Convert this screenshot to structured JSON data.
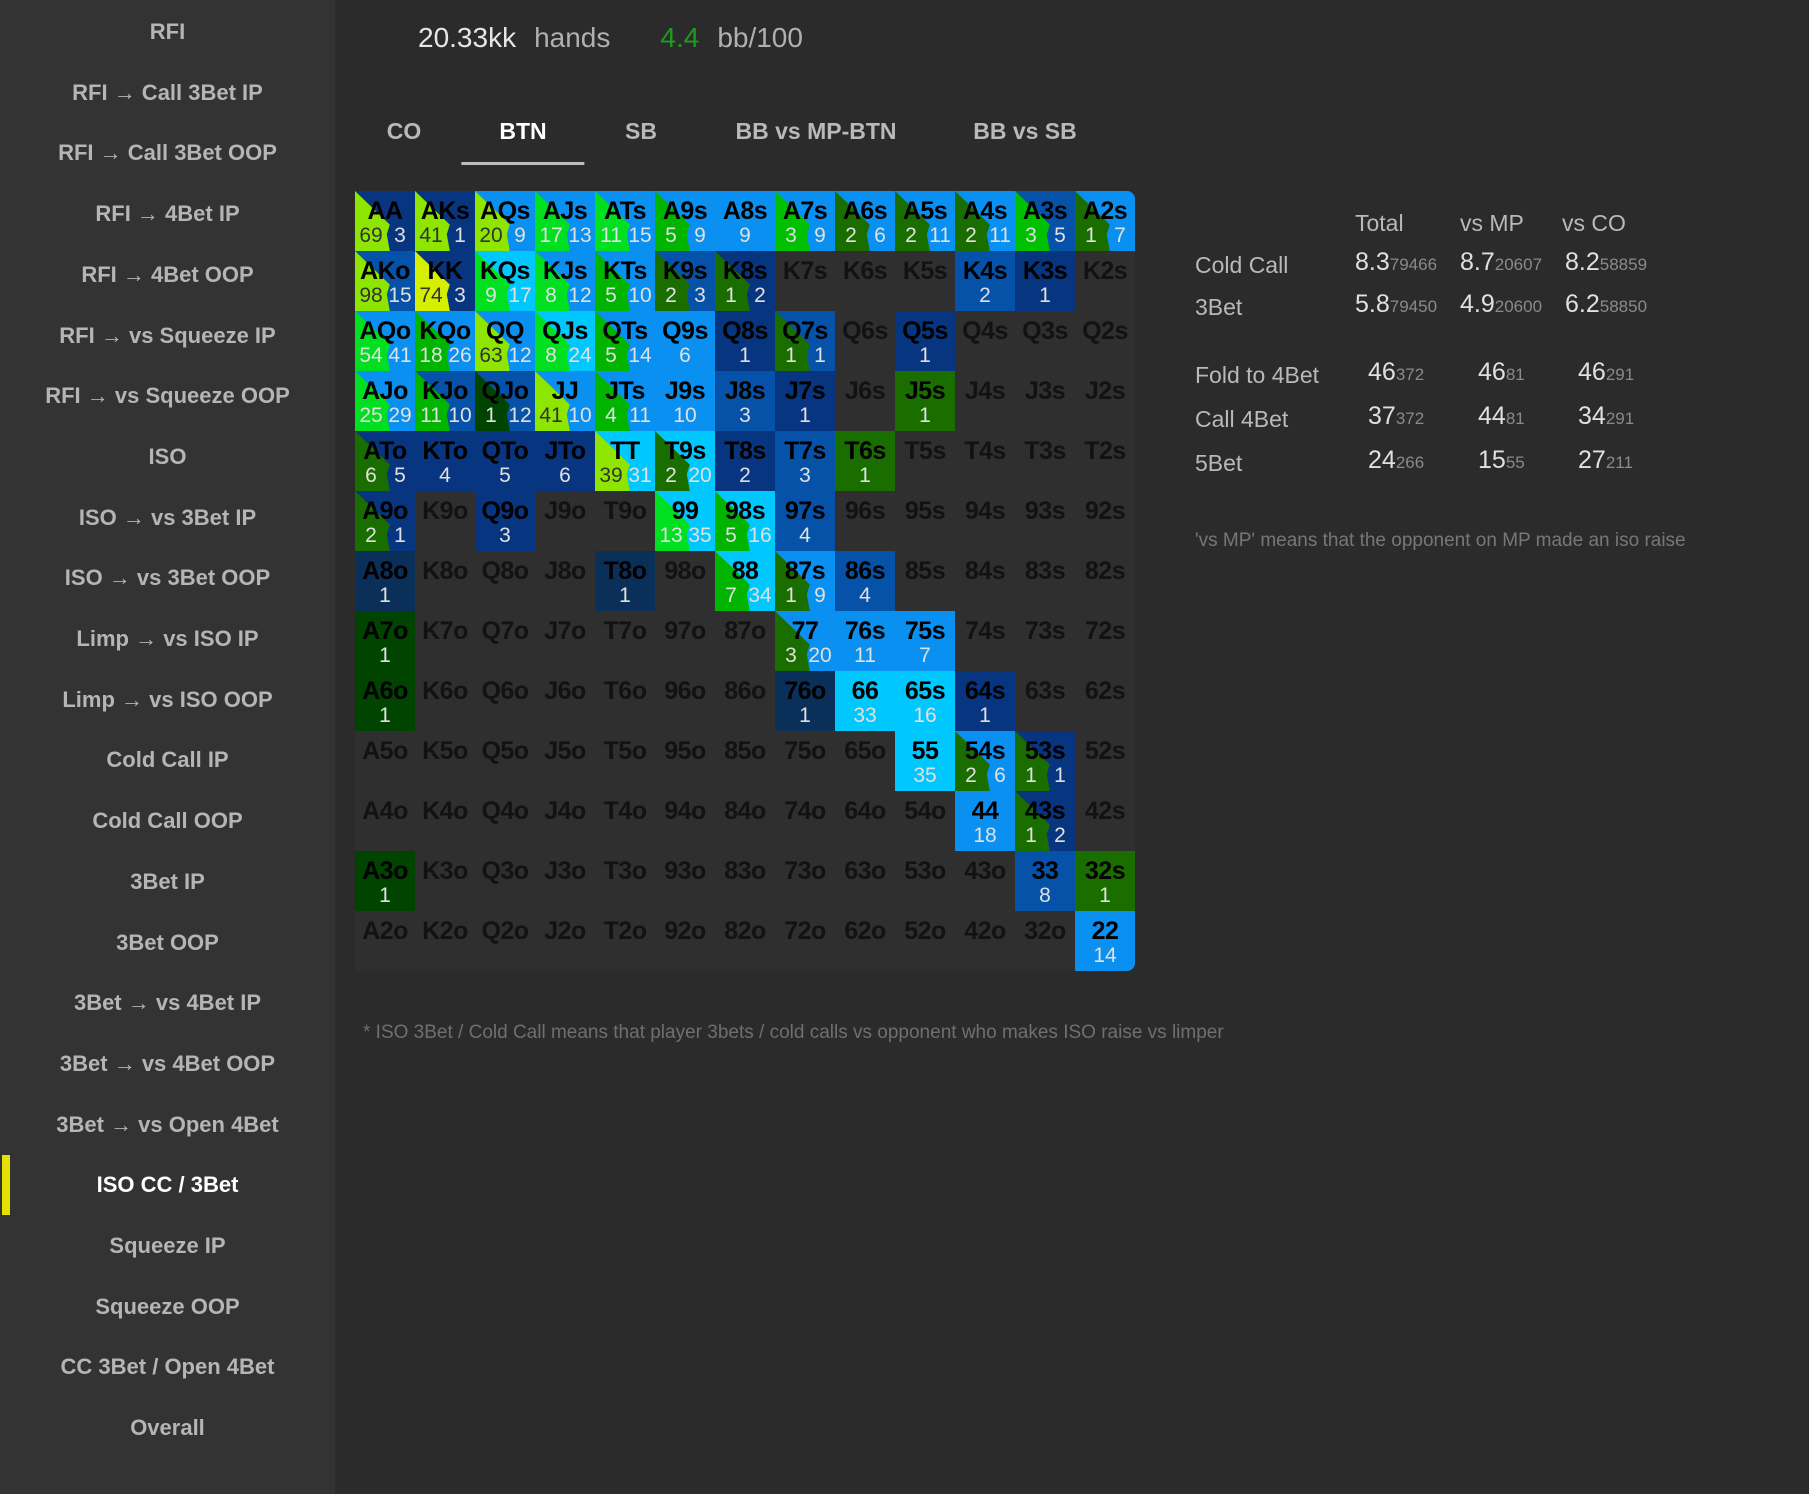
{
  "sidebar": {
    "items": [
      "RFI",
      "RFI → Call 3Bet IP",
      "RFI → Call 3Bet OOP",
      "RFI → 4Bet IP",
      "RFI → 4Bet OOP",
      "RFI → vs Squeeze IP",
      "RFI → vs Squeeze OOP",
      "ISO",
      "ISO → vs 3Bet IP",
      "ISO → vs 3Bet OOP",
      "Limp → vs ISO IP",
      "Limp → vs ISO OOP",
      "Cold Call IP",
      "Cold Call OOP",
      "3Bet IP",
      "3Bet OOP",
      "3Bet → vs 4Bet IP",
      "3Bet → vs 4Bet OOP",
      "3Bet → vs Open 4Bet",
      "ISO CC / 3Bet",
      "Squeeze IP",
      "Squeeze OOP",
      "CC 3Bet / Open 4Bet",
      "Overall"
    ],
    "active": "ISO CC / 3Bet",
    "active_color": "#e4e000"
  },
  "header": {
    "hands": "20.33kk",
    "hands_label": "hands",
    "winrate": "4.4",
    "winrate_label": "bb/100",
    "winrate_color": "#1f9a1f"
  },
  "tabs": {
    "items": [
      "CO",
      "BTN",
      "SB",
      "BB vs MP-BTN",
      "BB vs SB"
    ],
    "active": "BTN"
  },
  "grid": [
    [
      {
        "h": "AA",
        "a": "69",
        "b": "3",
        "c1": "#8ee600",
        "c2": "#08357f"
      },
      {
        "h": "AKs",
        "a": "41",
        "b": "1",
        "c1": "#8ee600",
        "c2": "#08357f"
      },
      {
        "h": "AQs",
        "a": "20",
        "b": "9",
        "c1": "#8ee600",
        "c2": "#0a90f0"
      },
      {
        "h": "AJs",
        "a": "17",
        "b": "13",
        "c1": "#00e020",
        "c2": "#0a90f0"
      },
      {
        "h": "ATs",
        "a": "11",
        "b": "15",
        "c1": "#00e020",
        "c2": "#0a90f0"
      },
      {
        "h": "A9s",
        "a": "5",
        "b": "9",
        "c1": "#00b400",
        "c2": "#0a90f0"
      },
      {
        "h": "A8s",
        "v": "9",
        "c2": "#0a90f0"
      },
      {
        "h": "A7s",
        "a": "3",
        "b": "9",
        "c1": "#00c000",
        "c2": "#0a90f0"
      },
      {
        "h": "A6s",
        "a": "2",
        "b": "6",
        "c1": "#1a6e00",
        "c2": "#0a90f0"
      },
      {
        "h": "A5s",
        "a": "2",
        "b": "11",
        "c1": "#1a6e00",
        "c2": "#0a90f0"
      },
      {
        "h": "A4s",
        "a": "2",
        "b": "11",
        "c1": "#1a6e00",
        "c2": "#0a90f0"
      },
      {
        "h": "A3s",
        "a": "3",
        "b": "5",
        "c1": "#00c000",
        "c2": "#0652a8"
      },
      {
        "h": "A2s",
        "a": "1",
        "b": "7",
        "c1": "#1a6e00",
        "c2": "#0a90f0"
      }
    ],
    [
      {
        "h": "AKo",
        "a": "98",
        "b": "15",
        "c1": "#8ee600",
        "c2": "#0652a8"
      },
      {
        "h": "KK",
        "a": "74",
        "b": "3",
        "c1": "#d4f000",
        "c2": "#08357f"
      },
      {
        "h": "KQs",
        "a": "9",
        "b": "17",
        "c1": "#00e020",
        "c2": "#00c8ff"
      },
      {
        "h": "KJs",
        "a": "8",
        "b": "12",
        "c1": "#00e020",
        "c2": "#0a90f0"
      },
      {
        "h": "KTs",
        "a": "5",
        "b": "10",
        "c1": "#00b400",
        "c2": "#0a90f0"
      },
      {
        "h": "K9s",
        "a": "2",
        "b": "3",
        "c1": "#1a6e00",
        "c2": "#0652a8"
      },
      {
        "h": "K8s",
        "a": "1",
        "b": "2",
        "c1": "#1a6e00",
        "c2": "#08357f"
      },
      {
        "h": "K7s"
      },
      {
        "h": "K6s"
      },
      {
        "h": "K5s"
      },
      {
        "h": "K4s",
        "v": "2",
        "c2": "#0652a8"
      },
      {
        "h": "K3s",
        "v": "1",
        "c2": "#08357f"
      },
      {
        "h": "K2s"
      }
    ],
    [
      {
        "h": "AQo",
        "a": "54",
        "b": "41",
        "c1": "#00e020",
        "c2": "#0a90f0"
      },
      {
        "h": "KQo",
        "a": "18",
        "b": "26",
        "c1": "#00b400",
        "c2": "#0a90f0"
      },
      {
        "h": "QQ",
        "a": "63",
        "b": "12",
        "c1": "#8ee600",
        "c2": "#0a90f0"
      },
      {
        "h": "QJs",
        "a": "8",
        "b": "24",
        "c1": "#00e020",
        "c2": "#00c8ff"
      },
      {
        "h": "QTs",
        "a": "5",
        "b": "14",
        "c1": "#00b400",
        "c2": "#0a90f0"
      },
      {
        "h": "Q9s",
        "v": "6",
        "c2": "#0a90f0"
      },
      {
        "h": "Q8s",
        "v": "1",
        "c2": "#08357f"
      },
      {
        "h": "Q7s",
        "a": "1",
        "b": "1",
        "c1": "#1a6e00",
        "c2": "#0652a8"
      },
      {
        "h": "Q6s"
      },
      {
        "h": "Q5s",
        "v": "1",
        "c2": "#08357f"
      },
      {
        "h": "Q4s"
      },
      {
        "h": "Q3s"
      },
      {
        "h": "Q2s"
      }
    ],
    [
      {
        "h": "AJo",
        "a": "25",
        "b": "29",
        "c1": "#00e020",
        "c2": "#0a90f0"
      },
      {
        "h": "KJo",
        "a": "11",
        "b": "10",
        "c1": "#00b400",
        "c2": "#0652a8"
      },
      {
        "h": "QJo",
        "a": "1",
        "b": "12",
        "c1": "#004400",
        "c2": "#0652a8"
      },
      {
        "h": "JJ",
        "a": "41",
        "b": "10",
        "c1": "#8ee600",
        "c2": "#0a90f0"
      },
      {
        "h": "JTs",
        "a": "4",
        "b": "11",
        "c1": "#00b400",
        "c2": "#0a90f0"
      },
      {
        "h": "J9s",
        "v": "10",
        "c2": "#0a90f0"
      },
      {
        "h": "J8s",
        "v": "3",
        "c2": "#0652a8"
      },
      {
        "h": "J7s",
        "v": "1",
        "c2": "#08357f"
      },
      {
        "h": "J6s"
      },
      {
        "h": "J5s",
        "v": "1",
        "c2": "#1a6e00"
      },
      {
        "h": "J4s"
      },
      {
        "h": "J3s"
      },
      {
        "h": "J2s"
      }
    ],
    [
      {
        "h": "ATo",
        "a": "6",
        "b": "5",
        "c1": "#1a6e00",
        "c2": "#08357f"
      },
      {
        "h": "KTo",
        "v": "4",
        "c2": "#08357f"
      },
      {
        "h": "QTo",
        "v": "5",
        "c2": "#08357f"
      },
      {
        "h": "JTo",
        "v": "6",
        "c2": "#08357f"
      },
      {
        "h": "TT",
        "a": "39",
        "b": "31",
        "c1": "#8ee600",
        "c2": "#00c8ff"
      },
      {
        "h": "T9s",
        "a": "2",
        "b": "20",
        "c1": "#1a6e00",
        "c2": "#00c8ff"
      },
      {
        "h": "T8s",
        "v": "2",
        "c2": "#08357f"
      },
      {
        "h": "T7s",
        "v": "3",
        "c2": "#0652a8"
      },
      {
        "h": "T6s",
        "v": "1",
        "c2": "#1a6e00"
      },
      {
        "h": "T5s"
      },
      {
        "h": "T4s"
      },
      {
        "h": "T3s"
      },
      {
        "h": "T2s"
      }
    ],
    [
      {
        "h": "A9o",
        "a": "2",
        "b": "1",
        "c1": "#1a6e00",
        "c2": "#08357f"
      },
      {
        "h": "K9o"
      },
      {
        "h": "Q9o",
        "v": "3",
        "c2": "#08357f"
      },
      {
        "h": "J9o"
      },
      {
        "h": "T9o"
      },
      {
        "h": "99",
        "a": "13",
        "b": "35",
        "c1": "#00e020",
        "c2": "#00c8ff"
      },
      {
        "h": "98s",
        "a": "5",
        "b": "16",
        "c1": "#00b400",
        "c2": "#00c8ff"
      },
      {
        "h": "97s",
        "v": "4",
        "c2": "#0652a8"
      },
      {
        "h": "96s"
      },
      {
        "h": "95s"
      },
      {
        "h": "94s"
      },
      {
        "h": "93s"
      },
      {
        "h": "92s"
      }
    ],
    [
      {
        "h": "A8o",
        "v": "1",
        "c2": "#0a3059"
      },
      {
        "h": "K8o"
      },
      {
        "h": "Q8o"
      },
      {
        "h": "J8o"
      },
      {
        "h": "T8o",
        "v": "1",
        "c2": "#0a3059"
      },
      {
        "h": "98o"
      },
      {
        "h": "88",
        "a": "7",
        "b": "34",
        "c1": "#00b400",
        "c2": "#00c8ff"
      },
      {
        "h": "87s",
        "a": "1",
        "b": "9",
        "c1": "#1a6e00",
        "c2": "#0a90f0"
      },
      {
        "h": "86s",
        "v": "4",
        "c2": "#0652a8"
      },
      {
        "h": "85s"
      },
      {
        "h": "84s"
      },
      {
        "h": "83s"
      },
      {
        "h": "82s"
      }
    ],
    [
      {
        "h": "A7o",
        "v": "1",
        "c2": "#004400"
      },
      {
        "h": "K7o"
      },
      {
        "h": "Q7o"
      },
      {
        "h": "J7o"
      },
      {
        "h": "T7o"
      },
      {
        "h": "97o"
      },
      {
        "h": "87o"
      },
      {
        "h": "77",
        "a": "3",
        "b": "20",
        "c1": "#1a6e00",
        "c2": "#0a90f0"
      },
      {
        "h": "76s",
        "v": "11",
        "c2": "#0a90f0"
      },
      {
        "h": "75s",
        "v": "7",
        "c2": "#0a90f0"
      },
      {
        "h": "74s"
      },
      {
        "h": "73s"
      },
      {
        "h": "72s"
      }
    ],
    [
      {
        "h": "A6o",
        "v": "1",
        "c2": "#004400"
      },
      {
        "h": "K6o"
      },
      {
        "h": "Q6o"
      },
      {
        "h": "J6o"
      },
      {
        "h": "T6o"
      },
      {
        "h": "96o"
      },
      {
        "h": "86o"
      },
      {
        "h": "76o",
        "v": "1",
        "c2": "#0a3059"
      },
      {
        "h": "66",
        "v": "33",
        "c2": "#00c8ff"
      },
      {
        "h": "65s",
        "v": "16",
        "c2": "#00c8ff"
      },
      {
        "h": "64s",
        "v": "1",
        "c2": "#08357f"
      },
      {
        "h": "63s"
      },
      {
        "h": "62s"
      }
    ],
    [
      {
        "h": "A5o"
      },
      {
        "h": "K5o"
      },
      {
        "h": "Q5o"
      },
      {
        "h": "J5o"
      },
      {
        "h": "T5o"
      },
      {
        "h": "95o"
      },
      {
        "h": "85o"
      },
      {
        "h": "75o"
      },
      {
        "h": "65o"
      },
      {
        "h": "55",
        "v": "35",
        "c2": "#00c8ff"
      },
      {
        "h": "54s",
        "a": "2",
        "b": "6",
        "c1": "#1a6e00",
        "c2": "#0a90f0"
      },
      {
        "h": "53s",
        "a": "1",
        "b": "1",
        "c1": "#1a6e00",
        "c2": "#08357f"
      },
      {
        "h": "52s"
      }
    ],
    [
      {
        "h": "A4o"
      },
      {
        "h": "K4o"
      },
      {
        "h": "Q4o"
      },
      {
        "h": "J4o"
      },
      {
        "h": "T4o"
      },
      {
        "h": "94o"
      },
      {
        "h": "84o"
      },
      {
        "h": "74o"
      },
      {
        "h": "64o"
      },
      {
        "h": "54o"
      },
      {
        "h": "44",
        "v": "18",
        "c2": "#0a90f0"
      },
      {
        "h": "43s",
        "a": "1",
        "b": "2",
        "c1": "#1a6e00",
        "c2": "#08357f"
      },
      {
        "h": "42s"
      }
    ],
    [
      {
        "h": "A3o",
        "v": "1",
        "c2": "#004400"
      },
      {
        "h": "K3o"
      },
      {
        "h": "Q3o"
      },
      {
        "h": "J3o"
      },
      {
        "h": "T3o"
      },
      {
        "h": "93o"
      },
      {
        "h": "83o"
      },
      {
        "h": "73o"
      },
      {
        "h": "63o"
      },
      {
        "h": "53o"
      },
      {
        "h": "43o"
      },
      {
        "h": "33",
        "v": "8",
        "c2": "#0652a8"
      },
      {
        "h": "32s",
        "v": "1",
        "c2": "#1a6e00"
      }
    ],
    [
      {
        "h": "A2o"
      },
      {
        "h": "K2o"
      },
      {
        "h": "Q2o"
      },
      {
        "h": "J2o"
      },
      {
        "h": "T2o"
      },
      {
        "h": "92o"
      },
      {
        "h": "82o"
      },
      {
        "h": "72o"
      },
      {
        "h": "62o"
      },
      {
        "h": "52o"
      },
      {
        "h": "42o"
      },
      {
        "h": "32o"
      },
      {
        "h": "22",
        "v": "14",
        "c2": "#0a90f0"
      }
    ]
  ],
  "stats": {
    "columns": [
      "Total",
      "vs MP",
      "vs CO"
    ],
    "rows": [
      {
        "label": "Cold Call",
        "cells": [
          [
            "8.3",
            "79466"
          ],
          [
            "8.7",
            "20607"
          ],
          [
            "8.2",
            "58859"
          ]
        ]
      },
      {
        "label": "3Bet",
        "cells": [
          [
            "5.8",
            "79450"
          ],
          [
            "4.9",
            "20600"
          ],
          [
            "6.2",
            "58850"
          ]
        ]
      },
      {
        "label": "Fold to 4Bet",
        "cells": [
          [
            "46",
            "372"
          ],
          [
            "46",
            "81"
          ],
          [
            "46",
            "291"
          ]
        ]
      },
      {
        "label": "Call 4Bet",
        "cells": [
          [
            "37",
            "372"
          ],
          [
            "44",
            "81"
          ],
          [
            "34",
            "291"
          ]
        ]
      },
      {
        "label": "5Bet",
        "cells": [
          [
            "24",
            "266"
          ],
          [
            "15",
            "55"
          ],
          [
            "27",
            "211"
          ]
        ]
      }
    ],
    "note": "'vs MP' means that the opponent on MP made an iso raise"
  },
  "footnote": "* ISO 3Bet / Cold Call means that player 3bets / cold calls vs opponent who makes ISO raise vs limper"
}
